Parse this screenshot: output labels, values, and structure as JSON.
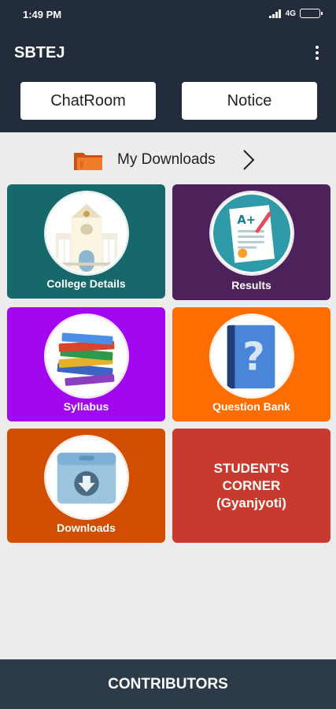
{
  "status_bar": {
    "time": "1:49 PM",
    "network": "4G",
    "battery_level": 0.85
  },
  "app_bar": {
    "title": "SBTEJ",
    "menu_icon": "more-vert-icon",
    "chatroom_label": "ChatRoom",
    "notice_label": "Notice"
  },
  "downloads_row": {
    "label": "My Downloads",
    "icon": "folder-icon",
    "chevron": "chevron-right-icon"
  },
  "tiles": [
    {
      "label": "College Details",
      "color": "#16686a",
      "icon": "college-building-icon"
    },
    {
      "label": "Results",
      "color": "#4d215a",
      "icon": "result-sheet-icon"
    },
    {
      "label": "Syllabus",
      "color": "#a108f0",
      "icon": "books-stack-icon"
    },
    {
      "label": "Question Bank",
      "color": "#fe6d00",
      "icon": "question-book-icon"
    },
    {
      "label": "Downloads",
      "color": "#d14d00",
      "icon": "download-folder-icon"
    },
    {
      "label_lines": [
        "STUDENT'S",
        "CORNER",
        "(Gyanjyoti)"
      ],
      "color": "#c8392e"
    }
  ],
  "footer": {
    "label": "CONTRIBUTORS"
  }
}
